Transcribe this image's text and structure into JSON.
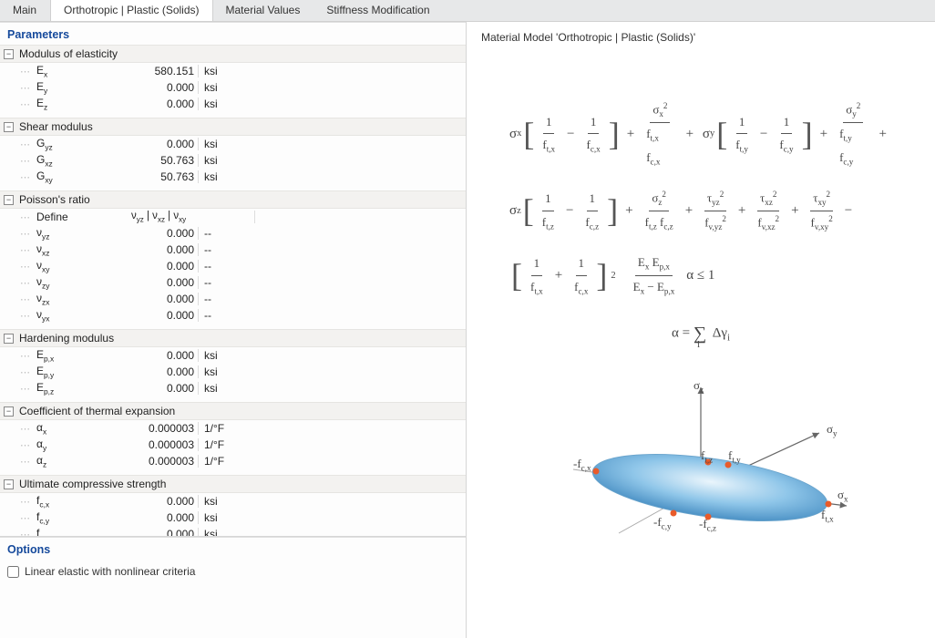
{
  "tabs": [
    "Main",
    "Orthotropic | Plastic (Solids)",
    "Material Values",
    "Stiffness Modification"
  ],
  "active_tab_index": 1,
  "left": {
    "parameters_title": "Parameters",
    "options_title": "Options",
    "checkbox_label": "Linear elastic with nonlinear criteria",
    "checkbox_checked": false,
    "groups": [
      {
        "name": "Modulus of elasticity",
        "rows": [
          {
            "label": "Eₓ",
            "value": "580.151",
            "unit": "ksi"
          },
          {
            "label": "Eᵧ",
            "value": "0.000",
            "unit": "ksi"
          },
          {
            "label": "E_z",
            "value": "0.000",
            "unit": "ksi"
          }
        ]
      },
      {
        "name": "Shear modulus",
        "rows": [
          {
            "label": "Gᵧ_z",
            "value": "0.000",
            "unit": "ksi"
          },
          {
            "label": "Gₓ_z",
            "value": "50.763",
            "unit": "ksi"
          },
          {
            "label": "Gₓᵧ",
            "value": "50.763",
            "unit": "ksi"
          }
        ]
      },
      {
        "name": "Poisson's ratio",
        "define_label": "Define",
        "define_value": "νyz | νxz | νxy",
        "rows": [
          {
            "label": "νᵧ_z",
            "value": "0.000",
            "unit": "--"
          },
          {
            "label": "νₓ_z",
            "value": "0.000",
            "unit": "--"
          },
          {
            "label": "νₓᵧ",
            "value": "0.000",
            "unit": "--"
          },
          {
            "label": "ν_zᵧ",
            "value": "0.000",
            "unit": "--"
          },
          {
            "label": "ν_zₓ",
            "value": "0.000",
            "unit": "--"
          },
          {
            "label": "νᵧₓ",
            "value": "0.000",
            "unit": "--"
          }
        ]
      },
      {
        "name": "Hardening modulus",
        "rows": [
          {
            "label": "Eₚ,ₓ",
            "value": "0.000",
            "unit": "ksi"
          },
          {
            "label": "Eₚ,ᵧ",
            "value": "0.000",
            "unit": "ksi"
          },
          {
            "label": "Eₚ,_z",
            "value": "0.000",
            "unit": "ksi"
          }
        ]
      },
      {
        "name": "Coefficient of thermal expansion",
        "rows": [
          {
            "label": "αₓ",
            "value": "0.000003",
            "unit": "1/°F"
          },
          {
            "label": "αᵧ",
            "value": "0.000003",
            "unit": "1/°F"
          },
          {
            "label": "α_z",
            "value": "0.000003",
            "unit": "1/°F"
          }
        ]
      },
      {
        "name": "Ultimate compressive strength",
        "rows": [
          {
            "label": "f꜀,ₓ",
            "value": "0.000",
            "unit": "ksi"
          },
          {
            "label": "f꜀,ᵧ",
            "value": "0.000",
            "unit": "ksi"
          },
          {
            "label": "f꜀,_z",
            "value": "0.000",
            "unit": "ksi"
          }
        ]
      }
    ]
  },
  "right": {
    "title": "Material Model 'Orthotropic | Plastic (Solids)'",
    "formula_terms": {
      "line1": "σx [1/ft,x − 1/fc,x] + σx²/(ft,x fc,x) + σy [1/ft,y − 1/fc,y] + σy²/(ft,y fc,y) +",
      "line2": "σz [1/ft,z − 1/fc,z] + σz²/(ft,z fc,z) + τyz²/fv,yz² + τxz²/fv,xz² + τxy²/fv,xy² −",
      "line3": "[1/ft,x + 1/fc,x]² · (Ex Ep,x)/(Ex − Ep,x) · α ≤ 1",
      "alpha": "α = Σᵢ Δγᵢ"
    },
    "diagram_labels": {
      "sigma_z": "σz",
      "sigma_y": "σy",
      "sigma_x": "σx",
      "ftz": "ft,z",
      "fty": "ft,y",
      "ftx": "ft,x",
      "fcx": "-fc,x",
      "fcy": "-fc,y",
      "fcz": "-fc,z"
    }
  }
}
